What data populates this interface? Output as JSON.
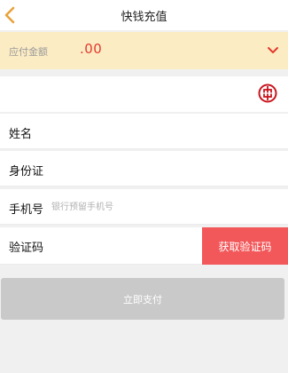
{
  "header": {
    "title": "快钱充值",
    "back_icon": "chevron-left-icon"
  },
  "amount": {
    "label": "应付金额",
    "value": ".00",
    "chevron_icon": "chevron-down-icon"
  },
  "bank": {
    "logo_icon": "icbc-bank-logo-icon"
  },
  "form": {
    "name_label": "姓名",
    "id_label": "身份证",
    "phone_label": "手机号",
    "phone_placeholder": "银行预留手机号",
    "code_label": "验证码",
    "get_code_label": "获取验证码"
  },
  "actions": {
    "pay_label": "立即支付"
  },
  "colors": {
    "accent": "#f2585a",
    "amount_bg": "#fcecc4",
    "amount_text": "#e23a2e",
    "back_arrow": "#e8a23c",
    "bank_logo": "#c8151d",
    "pay_disabled": "#c9c9c9"
  }
}
